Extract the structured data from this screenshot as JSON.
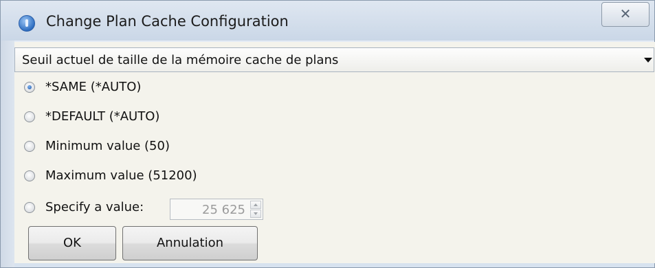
{
  "window": {
    "title": "Change Plan Cache Configuration",
    "close_label": "✕"
  },
  "dropdown": {
    "selected": "Seuil actuel de taille de la mémoire cache de plans"
  },
  "options": [
    {
      "label": "*SAME (*AUTO)",
      "selected": true
    },
    {
      "label": "*DEFAULT (*AUTO)",
      "selected": false
    },
    {
      "label": "Minimum value (50)",
      "selected": false
    },
    {
      "label": "Maximum value (51200)",
      "selected": false
    },
    {
      "label": "Specify a value:",
      "selected": false
    }
  ],
  "spinner": {
    "value": "25 625"
  },
  "buttons": {
    "ok": "OK",
    "cancel": "Annulation"
  },
  "colors": {
    "titlebar": "#cad7e7",
    "content_bg": "#f4f3ec",
    "radio_selected": "#1f57a8"
  }
}
